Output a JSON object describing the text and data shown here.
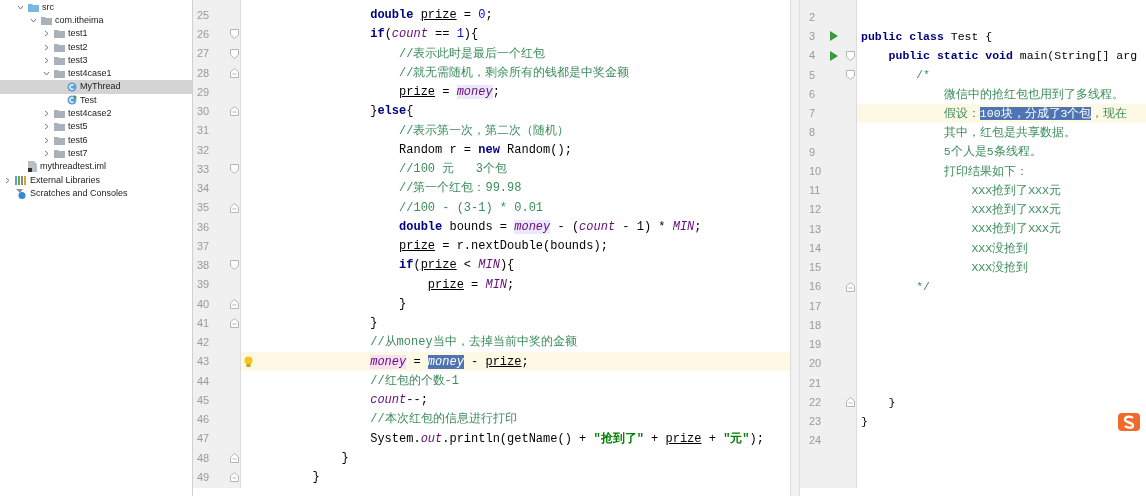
{
  "project_contents": [
    {
      "label": "src",
      "kind": "src-folder",
      "expanded": true,
      "selected": false,
      "children": [
        {
          "label": "com.itheima",
          "kind": "package",
          "expanded": true,
          "selected": false,
          "children": [
            {
              "label": "test1",
              "kind": "package",
              "expanded": false,
              "selected": false
            },
            {
              "label": "test2",
              "kind": "package",
              "expanded": false,
              "selected": false
            },
            {
              "label": "test3",
              "kind": "package",
              "expanded": false,
              "selected": false
            },
            {
              "label": "test4case1",
              "kind": "package",
              "expanded": true,
              "selected": false,
              "children": [
                {
                  "label": "MyThread",
                  "kind": "class",
                  "selected": true
                },
                {
                  "label": "Test",
                  "kind": "runnable-class",
                  "selected": false
                }
              ]
            },
            {
              "label": "test4case2",
              "kind": "package",
              "expanded": false,
              "selected": false
            },
            {
              "label": "test5",
              "kind": "package",
              "expanded": false,
              "selected": false
            },
            {
              "label": "test6",
              "kind": "package",
              "expanded": false,
              "selected": false
            },
            {
              "label": "test7",
              "kind": "package",
              "expanded": false,
              "selected": false
            }
          ]
        }
      ]
    },
    {
      "label": "mythreadtest.iml",
      "kind": "module-file",
      "selected": false
    }
  ],
  "tree": [
    {
      "label": "External Libraries",
      "kind": "libraries",
      "expanded": false,
      "selected": false
    },
    {
      "label": "Scratches and Consoles",
      "kind": "scratches",
      "selected": false
    }
  ],
  "left_editor": {
    "lines": [
      {
        "number": "25",
        "tokens": [
          {
            "text": "                double ",
            "kind": "keyword"
          },
          {
            "text": "prize",
            "kind": "local"
          },
          {
            "text": " = ",
            "kind": "plain"
          },
          {
            "text": "0",
            "kind": "number"
          },
          {
            "text": ";",
            "kind": "plain"
          }
        ]
      },
      {
        "number": "26",
        "fold": {
          "kind": "start"
        },
        "tokens": [
          {
            "text": "                if",
            "kind": "keyword"
          },
          {
            "text": "(",
            "kind": "plain"
          },
          {
            "text": "count",
            "kind": "field"
          },
          {
            "text": " == ",
            "kind": "plain"
          },
          {
            "text": "1",
            "kind": "number"
          },
          {
            "text": "){",
            "kind": "plain"
          }
        ]
      },
      {
        "number": "27",
        "fold": {
          "kind": "start"
        },
        "tokens": [
          {
            "text": "                    //表示此时是最后一个红包",
            "kind": "comment"
          }
        ]
      },
      {
        "number": "28",
        "fold": {
          "kind": "end"
        },
        "tokens": [
          {
            "text": "                    //就无需随机，剩余所有的钱都是中奖金额",
            "kind": "comment"
          }
        ]
      },
      {
        "number": "29",
        "tokens": [
          {
            "text": "                    prize",
            "kind": "local"
          },
          {
            "text": " = ",
            "kind": "plain"
          },
          {
            "text": "money",
            "kind": "field",
            "highlight": {
              "kind": "read"
            }
          },
          {
            "text": ";",
            "kind": "plain"
          }
        ]
      },
      {
        "number": "30",
        "fold": {
          "kind": "end"
        },
        "tokens": [
          {
            "text": "                }",
            "kind": "plain"
          },
          {
            "text": "else",
            "kind": "keyword"
          },
          {
            "text": "{",
            "kind": "plain"
          }
        ]
      },
      {
        "number": "31",
        "tokens": [
          {
            "text": "                    //表示第一次，第二次（随机）",
            "kind": "comment"
          }
        ]
      },
      {
        "number": "32",
        "tokens": [
          {
            "text": "                    Random r = ",
            "kind": "plain"
          },
          {
            "text": "new",
            "kind": "keyword"
          },
          {
            "text": " Random();",
            "kind": "plain"
          }
        ]
      },
      {
        "number": "33",
        "fold": {
          "kind": "start"
        },
        "tokens": [
          {
            "text": "                    //100 元   3个包",
            "kind": "comment"
          }
        ]
      },
      {
        "number": "34",
        "tokens": [
          {
            "text": "                    //第一个红包：99.98",
            "kind": "comment"
          }
        ]
      },
      {
        "number": "35",
        "fold": {
          "kind": "end"
        },
        "tokens": [
          {
            "text": "                    //100 - (3-1) * 0.01",
            "kind": "comment"
          }
        ]
      },
      {
        "number": "36",
        "tokens": [
          {
            "text": "                    double",
            "kind": "keyword"
          },
          {
            "text": " bounds = ",
            "kind": "plain"
          },
          {
            "text": "money",
            "kind": "field",
            "highlight": {
              "kind": "read"
            }
          },
          {
            "text": " - (",
            "kind": "plain"
          },
          {
            "text": "count",
            "kind": "field"
          },
          {
            "text": " - 1) * ",
            "kind": "plain"
          },
          {
            "text": "MIN",
            "kind": "field"
          },
          {
            "text": ";",
            "kind": "plain"
          }
        ]
      },
      {
        "number": "37",
        "tokens": [
          {
            "text": "                    prize",
            "kind": "local"
          },
          {
            "text": " = r.nextDouble(bounds);",
            "kind": "plain"
          }
        ]
      },
      {
        "number": "38",
        "fold": {
          "kind": "start"
        },
        "tokens": [
          {
            "text": "                    if",
            "kind": "keyword"
          },
          {
            "text": "(",
            "kind": "plain"
          },
          {
            "text": "prize",
            "kind": "local"
          },
          {
            "text": " < ",
            "kind": "plain"
          },
          {
            "text": "MIN",
            "kind": "field"
          },
          {
            "text": "){",
            "kind": "plain"
          }
        ]
      },
      {
        "number": "39",
        "tokens": [
          {
            "text": "                        prize",
            "kind": "local"
          },
          {
            "text": " = ",
            "kind": "plain"
          },
          {
            "text": "MIN",
            "kind": "field"
          },
          {
            "text": ";",
            "kind": "plain"
          }
        ]
      },
      {
        "number": "40",
        "fold": {
          "kind": "end"
        },
        "tokens": [
          {
            "text": "                    }",
            "kind": "plain"
          }
        ]
      },
      {
        "number": "41",
        "fold": {
          "kind": "end"
        },
        "tokens": [
          {
            "text": "                }",
            "kind": "plain"
          }
        ]
      },
      {
        "number": "42",
        "tokens": [
          {
            "text": "                //从money当中，去掉当前中奖的金额",
            "kind": "comment"
          }
        ]
      },
      {
        "number": "43",
        "current": true,
        "intention": true,
        "tokens": [
          {
            "text": "                money",
            "kind": "field",
            "highlight": {
              "kind": "write"
            }
          },
          {
            "text": " = ",
            "kind": "plain"
          },
          {
            "text": "money",
            "kind": "field",
            "highlight": {
              "kind": "selected"
            }
          },
          {
            "text": " - ",
            "kind": "plain"
          },
          {
            "text": "prize",
            "kind": "local"
          },
          {
            "text": ";",
            "kind": "plain"
          }
        ]
      },
      {
        "number": "44",
        "tokens": [
          {
            "text": "                //红包的个数-1",
            "kind": "comment"
          }
        ]
      },
      {
        "number": "45",
        "tokens": [
          {
            "text": "                count",
            "kind": "field"
          },
          {
            "text": "--;",
            "kind": "plain"
          }
        ]
      },
      {
        "number": "46",
        "tokens": [
          {
            "text": "                //本次红包的信息进行打印",
            "kind": "comment"
          }
        ]
      },
      {
        "number": "47",
        "tokens": [
          {
            "text": "                System.",
            "kind": "plain"
          },
          {
            "text": "out",
            "kind": "field"
          },
          {
            "text": ".println(getName() + ",
            "kind": "plain"
          },
          {
            "text": "\"抢到了\"",
            "kind": "string"
          },
          {
            "text": " + ",
            "kind": "plain"
          },
          {
            "text": "prize",
            "kind": "local"
          },
          {
            "text": " + ",
            "kind": "plain"
          },
          {
            "text": "\"元\"",
            "kind": "string"
          },
          {
            "text": ");",
            "kind": "plain"
          }
        ]
      },
      {
        "number": "48",
        "fold": {
          "kind": "end"
        },
        "tokens": [
          {
            "text": "            }",
            "kind": "plain"
          }
        ]
      },
      {
        "number": "49",
        "fold": {
          "kind": "end"
        },
        "tokens": [
          {
            "text": "        }",
            "kind": "plain"
          }
        ]
      }
    ]
  },
  "right_editor": {
    "lines": [
      {
        "number": "2"
      },
      {
        "number": "3",
        "run": true,
        "tokens": [
          {
            "text": "public class",
            "kind": "keyword"
          },
          {
            "text": " Test {",
            "kind": "plain"
          }
        ]
      },
      {
        "number": "4",
        "run": true,
        "fold": {
          "kind": "start"
        },
        "tokens": [
          {
            "text": "    public static void",
            "kind": "keyword"
          },
          {
            "text": " main(String[] arg",
            "kind": "plain"
          }
        ]
      },
      {
        "number": "5",
        "fold": {
          "kind": "start"
        },
        "tokens": [
          {
            "text": "        /*",
            "kind": "comment"
          }
        ]
      },
      {
        "number": "6",
        "tokens": [
          {
            "text": "            微信中的抢红包也用到了多线程。",
            "kind": "comment"
          }
        ]
      },
      {
        "number": "7",
        "current": true,
        "tokens": [
          {
            "text": "            假设：",
            "kind": "comment"
          },
          {
            "text": "100块，分成了3个包",
            "kind": "comment",
            "highlight": {
              "kind": "selected"
            }
          },
          {
            "text": "，现在",
            "kind": "comment"
          }
        ]
      },
      {
        "number": "8",
        "tokens": [
          {
            "text": "            其中，红包是共享数据。",
            "kind": "comment"
          }
        ]
      },
      {
        "number": "9",
        "tokens": [
          {
            "text": "            5个人是5条线程。",
            "kind": "comment"
          }
        ]
      },
      {
        "number": "10",
        "tokens": [
          {
            "text": "            打印结果如下：",
            "kind": "comment"
          }
        ]
      },
      {
        "number": "11",
        "tokens": [
          {
            "text": "                XXX抢到了XXX元",
            "kind": "comment"
          }
        ]
      },
      {
        "number": "12",
        "tokens": [
          {
            "text": "                XXX抢到了XXX元",
            "kind": "comment"
          }
        ]
      },
      {
        "number": "13",
        "tokens": [
          {
            "text": "                XXX抢到了XXX元",
            "kind": "comment"
          }
        ]
      },
      {
        "number": "14",
        "tokens": [
          {
            "text": "                XXX没抢到",
            "kind": "comment"
          }
        ]
      },
      {
        "number": "15",
        "tokens": [
          {
            "text": "                XXX没抢到",
            "kind": "comment"
          }
        ]
      },
      {
        "number": "16",
        "fold": {
          "kind": "end"
        },
        "tokens": [
          {
            "text": "        */",
            "kind": "comment"
          }
        ]
      },
      {
        "number": "17"
      },
      {
        "number": "18"
      },
      {
        "number": "19"
      },
      {
        "number": "20"
      },
      {
        "number": "21"
      },
      {
        "number": "22",
        "fold": {
          "kind": "end"
        },
        "tokens": [
          {
            "text": "    }",
            "kind": "plain"
          }
        ]
      },
      {
        "number": "23",
        "tokens": [
          {
            "text": "}",
            "kind": "plain"
          }
        ]
      },
      {
        "number": "24"
      }
    ]
  }
}
